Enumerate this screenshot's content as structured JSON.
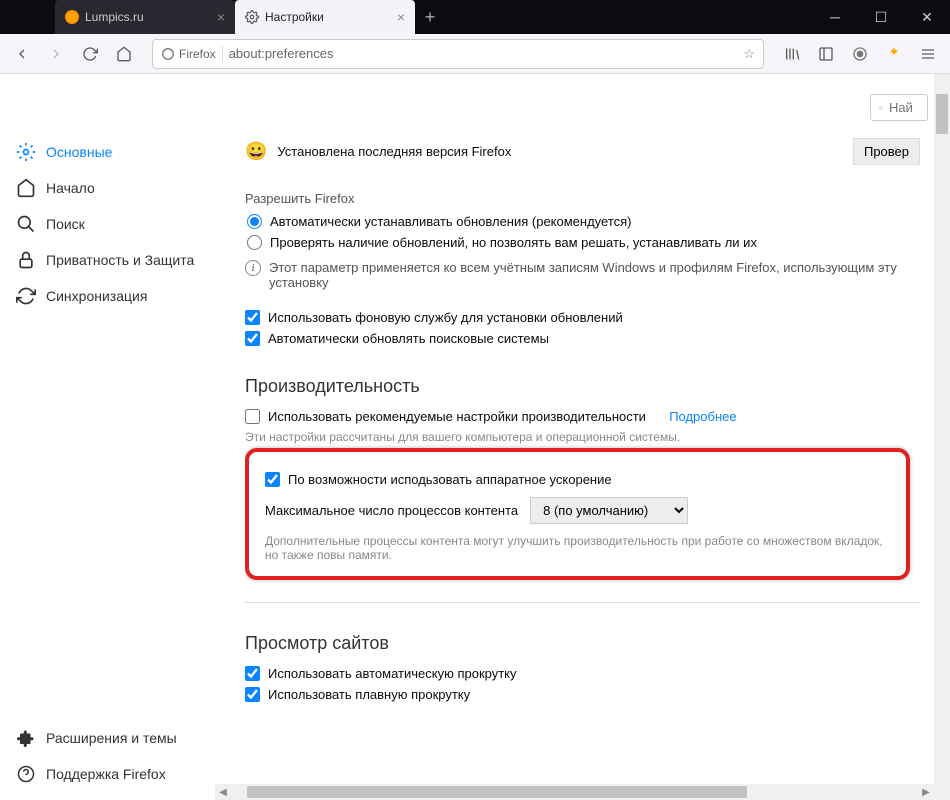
{
  "titlebar": {
    "tabs": [
      {
        "label": "Lumpics.ru",
        "active": false
      },
      {
        "label": "Настройки",
        "active": true
      }
    ]
  },
  "urlbar": {
    "identity": "Firefox",
    "url": "about:preferences"
  },
  "sidebar": {
    "items": [
      {
        "id": "general",
        "label": "Основные",
        "active": true
      },
      {
        "id": "home",
        "label": "Начало"
      },
      {
        "id": "search",
        "label": "Поиск"
      },
      {
        "id": "privacy",
        "label": "Приватность и Защита"
      },
      {
        "id": "sync",
        "label": "Синхронизация"
      }
    ],
    "footer": [
      {
        "id": "extensions",
        "label": "Расширения и темы"
      },
      {
        "id": "support",
        "label": "Поддержка Firefox"
      }
    ]
  },
  "search": {
    "placeholder": "Най"
  },
  "updates": {
    "status": "Установлена последняя версия Firefox",
    "check_button": "Провер",
    "allow_label": "Разрешить Firefox",
    "radio_auto": "Автоматически устанавливать обновления (рекомендуется)",
    "radio_check": "Проверять наличие обновлений, но позволять вам решать, устанавливать ли их",
    "info": "Этот параметр применяется ко всем учётным записям Windows и профилям Firefox, использующим эту установку",
    "check_bg": "Использовать фоновую службу для установки обновлений",
    "check_engines": "Автоматически обновлять поисковые системы"
  },
  "perf": {
    "title": "Производительность",
    "use_recommended": "Использовать рекомендуемые настройки производительности",
    "learn_more": "Подробнее",
    "help1": "Эти настройки рассчитаны для вашего компьютера и операционной системы.",
    "hw_accel": "По возможности исподьзовать аппаратное ускорение",
    "proc_label": "Максимальное число процессов контента",
    "proc_value": "8 (по умолчанию)",
    "help2": "Дополнительные процессы контента могут улучшить производительность при работе со множеством вкладок, но также повы памяти."
  },
  "browsing": {
    "title": "Просмотр сайтов",
    "autoscroll": "Использовать автоматическую прокрутку",
    "smoothscroll": "Использовать плавную прокрутку"
  }
}
